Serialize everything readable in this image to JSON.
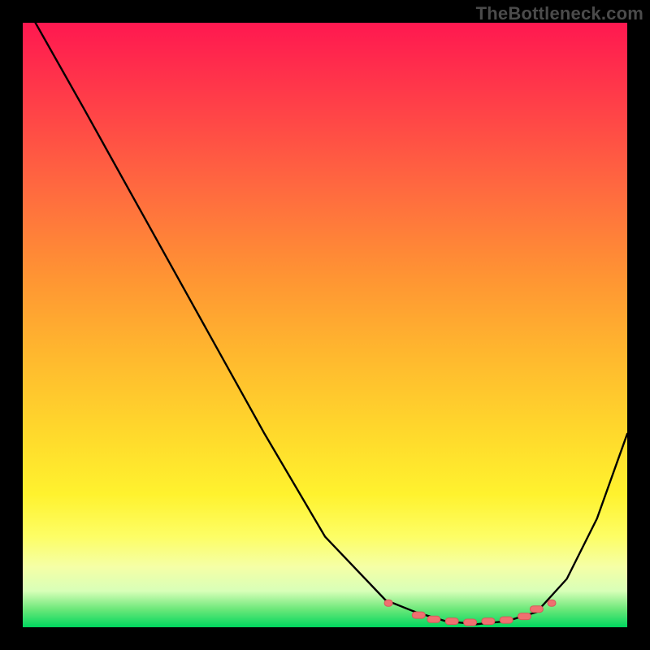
{
  "watermark": "TheBottleneck.com",
  "chart_data": {
    "type": "line",
    "title": "",
    "xlabel": "",
    "ylabel": "",
    "x": [
      0.0,
      0.021,
      0.1,
      0.2,
      0.3,
      0.4,
      0.5,
      0.6,
      0.65,
      0.7,
      0.75,
      0.8,
      0.85,
      0.9,
      0.95,
      1.0
    ],
    "y": [
      1.05,
      1.0,
      0.86,
      0.68,
      0.5,
      0.32,
      0.15,
      0.045,
      0.025,
      0.01,
      0.005,
      0.01,
      0.025,
      0.08,
      0.18,
      0.32
    ],
    "xlim": [
      0,
      1
    ],
    "ylim": [
      0,
      1
    ],
    "markers": {
      "x": [
        0.605,
        0.655,
        0.68,
        0.71,
        0.74,
        0.77,
        0.8,
        0.83,
        0.85,
        0.875
      ],
      "y": [
        0.04,
        0.02,
        0.013,
        0.01,
        0.008,
        0.01,
        0.012,
        0.018,
        0.03,
        0.04
      ]
    },
    "gradient_colors": [
      "#ff1850",
      "#ff9433",
      "#ffd92c",
      "#fdfe65",
      "#00d65e"
    ]
  }
}
